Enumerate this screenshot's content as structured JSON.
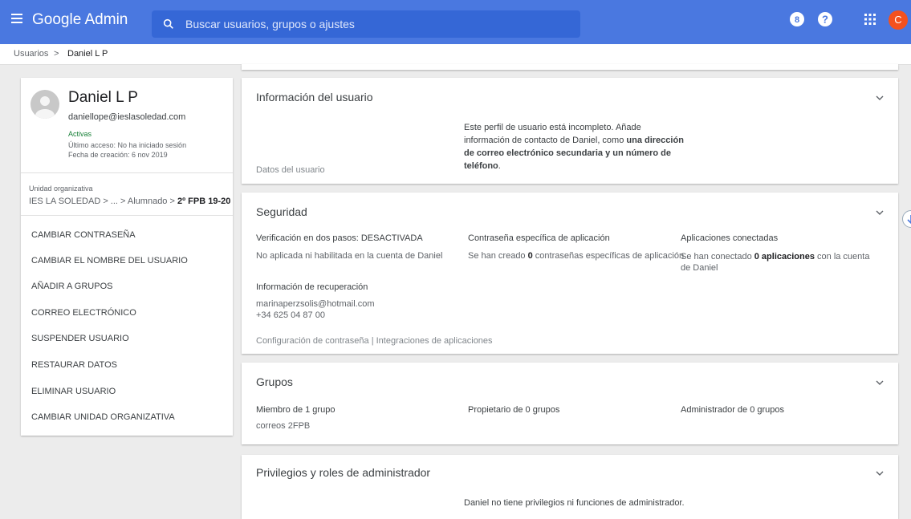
{
  "app": {
    "title": "Google Admin"
  },
  "search": {
    "placeholder": "Buscar usuarios, grupos o ajustes"
  },
  "header": {
    "avatar_letter": "C",
    "colors": {
      "bar": "#4a78e0",
      "avatar": "#f4511e"
    }
  },
  "breadcrumb": {
    "home": "Usuarios",
    "separator": ">",
    "current": "Daniel L P"
  },
  "user": {
    "name": "Daniel L P",
    "email": "daniellope@ieslasoledad.com",
    "status": "Activas",
    "last_access": "Último acceso: No ha iniciado sesión",
    "created": "Fecha de creación: 6 nov 2019"
  },
  "org_unit": {
    "label": "Unidad organizativa",
    "path_prefix": "IES LA SOLEDAD > ... > Alumnado > ",
    "path_current": "2º FPB 19-20"
  },
  "actions": [
    "CAMBIAR CONTRASEÑA",
    "CAMBIAR EL NOMBRE DEL USUARIO",
    "AÑADIR A GRUPOS",
    "CORREO ELECTRÓNICO",
    "SUSPENDER USUARIO",
    "RESTAURAR DATOS",
    "ELIMINAR USUARIO",
    "CAMBIAR UNIDAD ORGANIZATIVA"
  ],
  "user_info": {
    "title": "Información del usuario",
    "message_part1": "Este perfil de usuario está incompleto. Añade información de contacto de Daniel, como ",
    "message_bold": "una dirección de correo electrónico secundaria y un número de teléfono",
    "message_part2": ".",
    "footer": "Datos del usuario"
  },
  "security": {
    "title": "Seguridad",
    "two_step_label": "Verificación en dos pasos: ",
    "two_step_value": "DESACTIVADA",
    "two_step_desc": "No aplicada ni habilitada en la cuenta de Daniel",
    "app_password_title": "Contraseña específica de aplicación",
    "app_password_desc_1": "Se han creado ",
    "app_password_count": "0",
    "app_password_desc_2": " contraseñas específicas de aplicación",
    "connected_title": "Aplicaciones conectadas",
    "connected_desc_1": "Se han conectado ",
    "connected_bold": "0 aplicaciones",
    "connected_desc_2": " con la cuenta de Daniel",
    "recovery_title": "Información de recuperación",
    "recovery_email": "marinaperzsolis@hotmail.com",
    "recovery_phone": "+34 625 04 87 00",
    "footer": "Configuración de contraseña | Integraciones de aplicaciones"
  },
  "groups": {
    "title": "Grupos",
    "member": "Miembro de 1 grupo",
    "member_group": "correos 2FPB",
    "owner": "Propietario de 0 grupos",
    "admin": "Administrador de 0 grupos"
  },
  "admin": {
    "title": "Privilegios y roles de administrador",
    "message": "Daniel no tiene privilegios ni funciones de administrador."
  }
}
